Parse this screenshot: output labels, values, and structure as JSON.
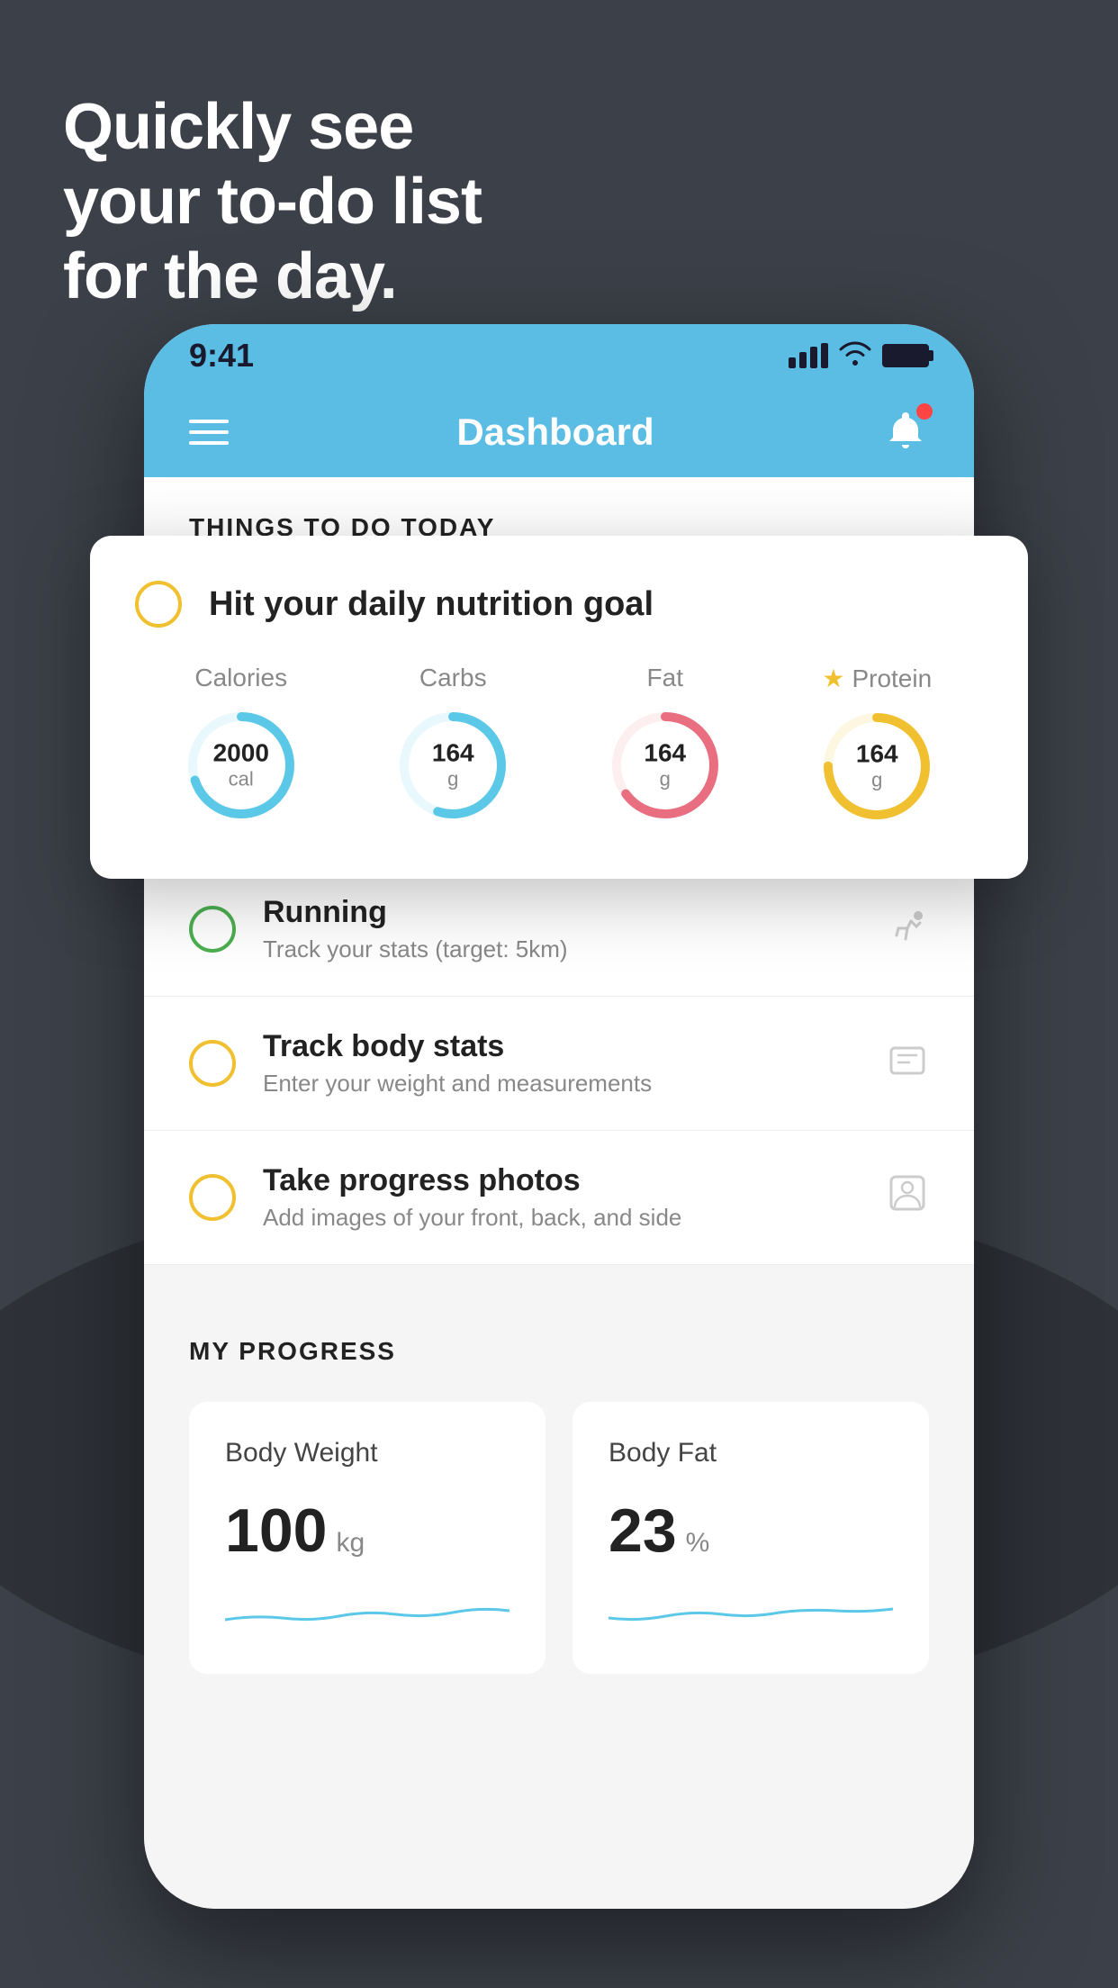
{
  "hero": {
    "line1": "Quickly see",
    "line2": "your to-do list",
    "line3": "for the day."
  },
  "status_bar": {
    "time": "9:41"
  },
  "nav": {
    "title": "Dashboard"
  },
  "things_today": {
    "section_title": "THINGS TO DO TODAY"
  },
  "nutrition_card": {
    "title": "Hit your daily nutrition goal",
    "macros": [
      {
        "label": "Calories",
        "value": "2000",
        "unit": "cal",
        "color": "#5bc8e8",
        "pct": 70,
        "star": false
      },
      {
        "label": "Carbs",
        "value": "164",
        "unit": "g",
        "color": "#5bc8e8",
        "pct": 55,
        "star": false
      },
      {
        "label": "Fat",
        "value": "164",
        "unit": "g",
        "color": "#e86e80",
        "pct": 65,
        "star": false
      },
      {
        "label": "Protein",
        "value": "164",
        "unit": "g",
        "color": "#f0c030",
        "pct": 75,
        "star": true
      }
    ]
  },
  "todo_items": [
    {
      "name": "Running",
      "desc": "Track your stats (target: 5km)",
      "circle_color": "green",
      "icon": "👟"
    },
    {
      "name": "Track body stats",
      "desc": "Enter your weight and measurements",
      "circle_color": "yellow",
      "icon": "⚖️"
    },
    {
      "name": "Take progress photos",
      "desc": "Add images of your front, back, and side",
      "circle_color": "yellow",
      "icon": "👤"
    }
  ],
  "progress": {
    "section_title": "MY PROGRESS",
    "cards": [
      {
        "title": "Body Weight",
        "value": "100",
        "unit": "kg"
      },
      {
        "title": "Body Fat",
        "value": "23",
        "unit": "%"
      }
    ]
  }
}
